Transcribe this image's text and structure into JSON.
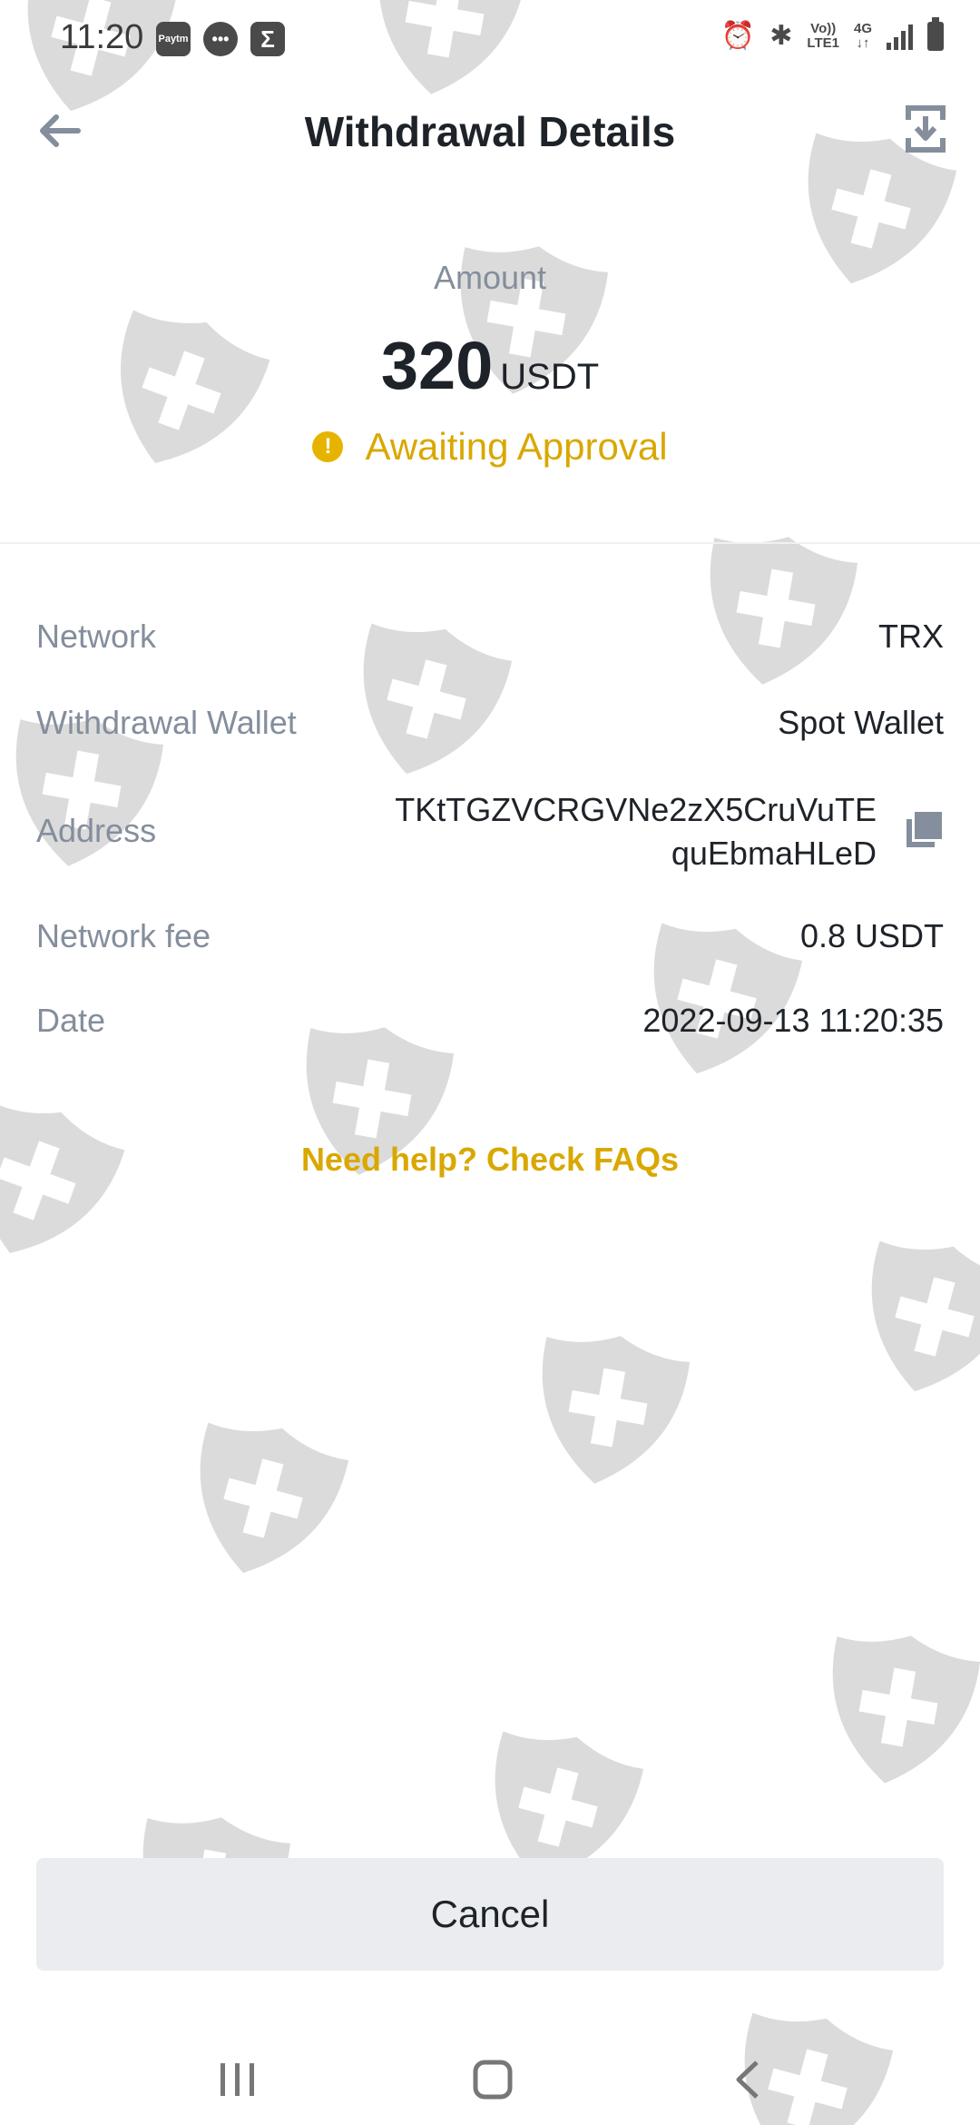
{
  "status_bar": {
    "time": "11:20",
    "app_icons": [
      "paytm-icon",
      "messages-icon",
      "sigma-app-icon"
    ],
    "paytm_label": "Paytm",
    "volte_top": "Vo))",
    "volte_bottom": "LTE1",
    "network_top": "4G",
    "network_bottom": "↓↑"
  },
  "header": {
    "title": "Withdrawal Details"
  },
  "summary": {
    "amount_label": "Amount",
    "amount_value": "320",
    "amount_unit": "USDT",
    "status": "Awaiting Approval"
  },
  "details": {
    "network_label": "Network",
    "network_value": "TRX",
    "wallet_label": "Withdrawal Wallet",
    "wallet_value": "Spot Wallet",
    "address_label": "Address",
    "address_line1": "TKtTGZVCRGVNe2zX5CruVuTE",
    "address_line2": "quEbmaHLeD",
    "fee_label": "Network fee",
    "fee_value": "0.8 USDT",
    "date_label": "Date",
    "date_value": "2022-09-13 11:20:35"
  },
  "help_link": "Need help? Check FAQs",
  "cancel_label": "Cancel",
  "colors": {
    "accent_gold": "#d9a800",
    "text_primary": "#1e2329",
    "text_secondary": "#848e9c",
    "button_bg": "#eaecef"
  }
}
